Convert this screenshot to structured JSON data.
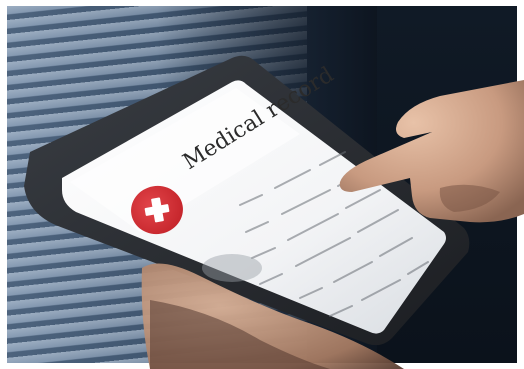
{
  "screen": {
    "title": "Medical record",
    "cross_icon": "medical-cross-icon"
  },
  "colors": {
    "accent_red": "#c8282e",
    "screen_white": "#f4f5f6",
    "tablet_frame": "#2a2d31",
    "background_blue": "#3f5670"
  }
}
